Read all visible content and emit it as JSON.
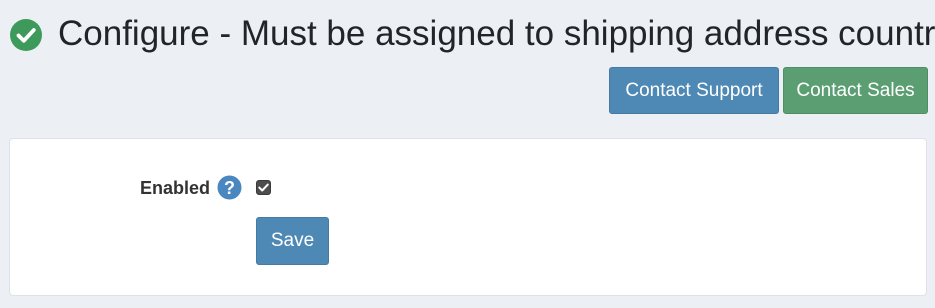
{
  "header": {
    "status_icon": "check-circle-icon",
    "title": "Configure - Must be assigned to shipping address country"
  },
  "actions": {
    "contact_support_label": "Contact Support",
    "contact_sales_label": "Contact Sales"
  },
  "form": {
    "enabled_label": "Enabled",
    "help_icon": "question-circle-icon",
    "enabled_checked": true,
    "save_label": "Save"
  },
  "colors": {
    "background": "#eceff4",
    "success_green": "#3e9a5a",
    "primary_blue": "#4e88b4",
    "sales_green": "#5a9e72",
    "help_blue": "#4a86c0"
  }
}
